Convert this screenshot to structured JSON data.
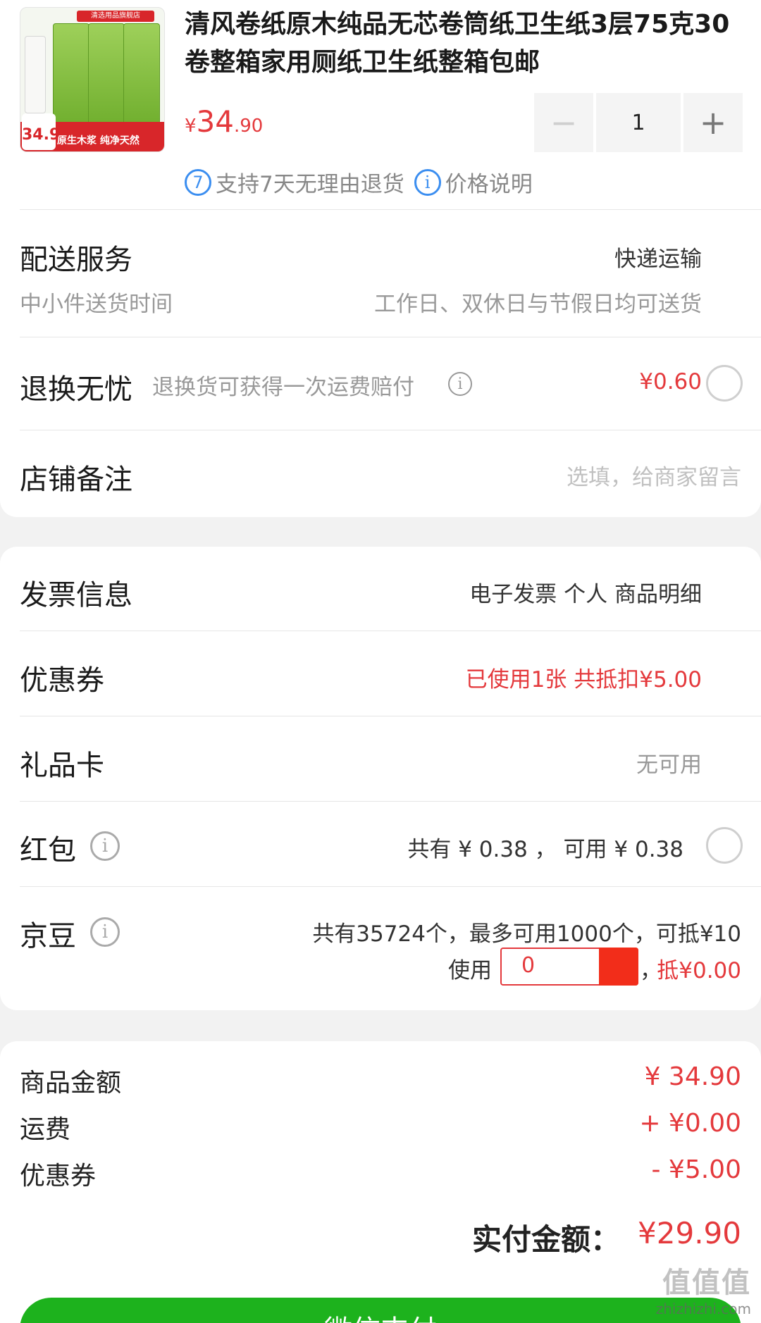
{
  "product": {
    "title": "清风卷纸原木纯品无芯卷筒纸卫生纸3层75克30卷整箱家用厕纸卫生纸整箱包邮",
    "image_alt": "清风卷纸商品图",
    "image_store_tag": "清选用品旗舰店",
    "image_banner": "原生木浆 纯净天然",
    "image_price": "34.9",
    "price_currency": "¥",
    "price_int": "34",
    "price_dec": ".90",
    "quantity": "1",
    "minus_label": "−",
    "plus_label": "+",
    "return_badge": "7",
    "return_text": "支持7天无理由退货",
    "price_info_icon": "i",
    "price_info_text": "价格说明"
  },
  "delivery": {
    "label": "配送服务",
    "value": "快递运输",
    "sub_label": "中小件送货时间",
    "sub_value": "工作日、双休日与节假日均可送货"
  },
  "return_insurance": {
    "label": "退换无忧",
    "desc": "退换货可获得一次运费赔付",
    "price": "¥0.60"
  },
  "store_note": {
    "label": "店铺备注",
    "placeholder": "选填，给商家留言"
  },
  "invoice": {
    "label": "发票信息",
    "value": "电子发票 个人 商品明细"
  },
  "coupon": {
    "label": "优惠券",
    "value": "已使用1张 共抵扣¥5.00"
  },
  "gift_card": {
    "label": "礼品卡",
    "value": "无可用"
  },
  "red_packet": {
    "label": "红包",
    "value": "共有 ¥ 0.38 ， 可用 ¥ 0.38"
  },
  "jd_beans": {
    "label": "京豆",
    "info": "共有35724个，最多可用1000个，可抵¥10",
    "use_label": "使用",
    "input_value": "0",
    "deduct_sep": "，",
    "deduct": "抵¥0.00"
  },
  "summary": {
    "goods_label": "商品金额",
    "goods_value": "¥ 34.90",
    "shipping_label": "运费",
    "shipping_value": "+ ¥0.00",
    "coupon_label": "优惠券",
    "coupon_value": "- ¥5.00",
    "total_label": "实付金额：",
    "total_value": "¥29.90"
  },
  "pay_button": {
    "label": "微信支付"
  },
  "watermark": {
    "text": "值值值",
    "url": "zhizhizhi.com"
  },
  "colors": {
    "accent_red": "#e4393c",
    "pay_green": "#1db21d",
    "info_blue": "#3b8ef0"
  }
}
